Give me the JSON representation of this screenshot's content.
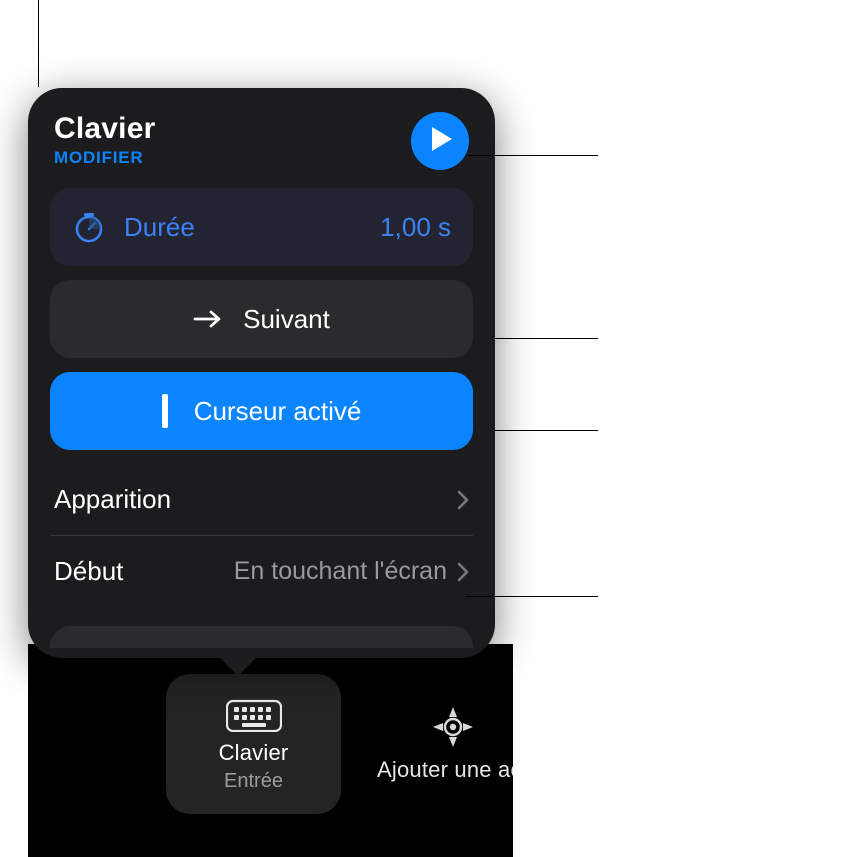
{
  "colors": {
    "accent": "#0a84ff",
    "panel": "#1c1b1d",
    "row": "#2b2a2c",
    "durationRow": "#232331",
    "mutedText": "#9a999e"
  },
  "popover": {
    "title": "Clavier",
    "editLabel": "MODIFIER",
    "duration": {
      "label": "Durée",
      "value": "1,00 s",
      "icon": "timer-icon"
    },
    "nextButton": {
      "label": "Suivant",
      "icon": "arrow-right-icon"
    },
    "cursorButton": {
      "label": "Curseur activé",
      "icon": "text-cursor-icon"
    },
    "rows": [
      {
        "key": "Apparition",
        "value": ""
      },
      {
        "key": "Début",
        "value": "En touchant l'écran"
      }
    ]
  },
  "bottomBar": {
    "primary": {
      "title": "Clavier",
      "subtitle": "Entrée",
      "icon": "keyboard-icon"
    },
    "secondary": {
      "title": "Ajouter une act",
      "icon": "target-icon"
    }
  }
}
